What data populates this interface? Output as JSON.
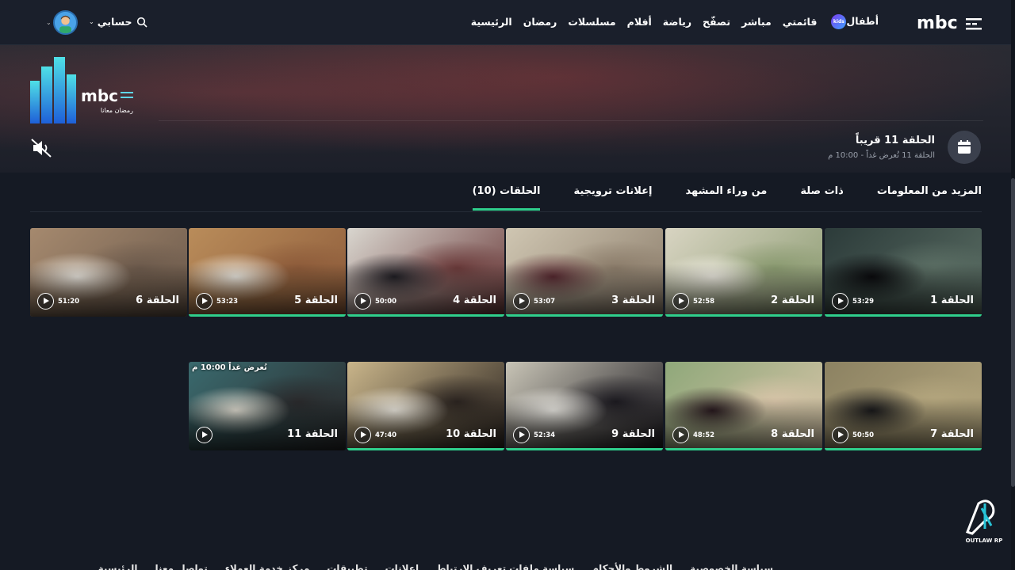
{
  "header": {
    "logo_text": "mbc",
    "nav": [
      {
        "label": "الرئيسية"
      },
      {
        "label": "رمضان"
      },
      {
        "label": "مسلسلات"
      },
      {
        "label": "أفلام"
      },
      {
        "label": "رياضة"
      },
      {
        "label": "تصفّح"
      },
      {
        "label": "مباشر"
      },
      {
        "label": "قائمتي"
      },
      {
        "label": "أطفال",
        "badge": "kids"
      }
    ],
    "account_label": "حسابي"
  },
  "hero": {
    "show_logo_text": "mbc",
    "show_logo_sub": "رمضان معانا",
    "next_title": "الحلقة 11 قريباً",
    "next_sub": "الحلقة 11 تُعرض غداً - 10:00 م"
  },
  "tabs": [
    {
      "label": "الحلقات (10)",
      "active": true
    },
    {
      "label": "إعلانات ترويجية",
      "active": false
    },
    {
      "label": "من وراء المشهد",
      "active": false
    },
    {
      "label": "ذات صلة",
      "active": false
    },
    {
      "label": "المزيد من المعلومات",
      "active": false
    }
  ],
  "episodes": [
    {
      "title": "الحلقة 1",
      "duration": "53:29",
      "watched": true,
      "palette": [
        "#2c3b3a",
        "#0b0b0e",
        "#5b6e64"
      ]
    },
    {
      "title": "الحلقة 2",
      "duration": "52:58",
      "watched": true,
      "palette": [
        "#d8d4c2",
        "#f3f0e6",
        "#8a9a70"
      ]
    },
    {
      "title": "الحلقة 3",
      "duration": "53:07",
      "watched": true,
      "palette": [
        "#cfc6b2",
        "#5a2a32",
        "#8b7c6a"
      ]
    },
    {
      "title": "الحلقة 4",
      "duration": "50:00",
      "watched": true,
      "palette": [
        "#d9d6cf",
        "#222026",
        "#6a3a3a"
      ]
    },
    {
      "title": "الحلقة 5",
      "duration": "53:23",
      "watched": true,
      "palette": [
        "#b98c5a",
        "#f1eee6",
        "#8d5b3a"
      ]
    },
    {
      "title": "الحلقة 6",
      "duration": "51:20",
      "watched": false,
      "palette": [
        "#a5896e",
        "#f0ece4",
        "#6c5a4c"
      ]
    },
    {
      "title": "الحلقة 7",
      "duration": "50:50",
      "watched": true,
      "palette": [
        "#8c8262",
        "#1a1a1c",
        "#b4a67e"
      ]
    },
    {
      "title": "الحلقة 8",
      "duration": "48:52",
      "watched": true,
      "palette": [
        "#8fa87a",
        "#2a1a20",
        "#d7c4a8"
      ]
    },
    {
      "title": "الحلقة 9",
      "duration": "52:34",
      "watched": true,
      "palette": [
        "#c8c4b6",
        "#f2f0ea",
        "#1c1a20"
      ]
    },
    {
      "title": "الحلقة 10",
      "duration": "47:40",
      "watched": true,
      "palette": [
        "#c9b58a",
        "#f4f0e6",
        "#2b2420"
      ]
    },
    {
      "title": "الحلقة 11",
      "duration": "",
      "watched": false,
      "soon": "تُعرض غداً 10:00 م",
      "palette": [
        "#3a6a6e",
        "#e6e2d6",
        "#2a2a2c"
      ]
    }
  ],
  "footer": {
    "links": [
      "الرئيسية",
      "تواصل معنا",
      "مركز خدمة العملاء",
      "تطبيقات",
      "إعلانات",
      "سياسة ملفات تعريف الارتباط",
      "الشروط والأحكام",
      "سياسة الخصوصية"
    ]
  },
  "watermark": {
    "text": "OUTLAW RP"
  },
  "colors": {
    "accent": "#2fcf8c",
    "background": "#151a24",
    "header": "#1a1f2b"
  }
}
